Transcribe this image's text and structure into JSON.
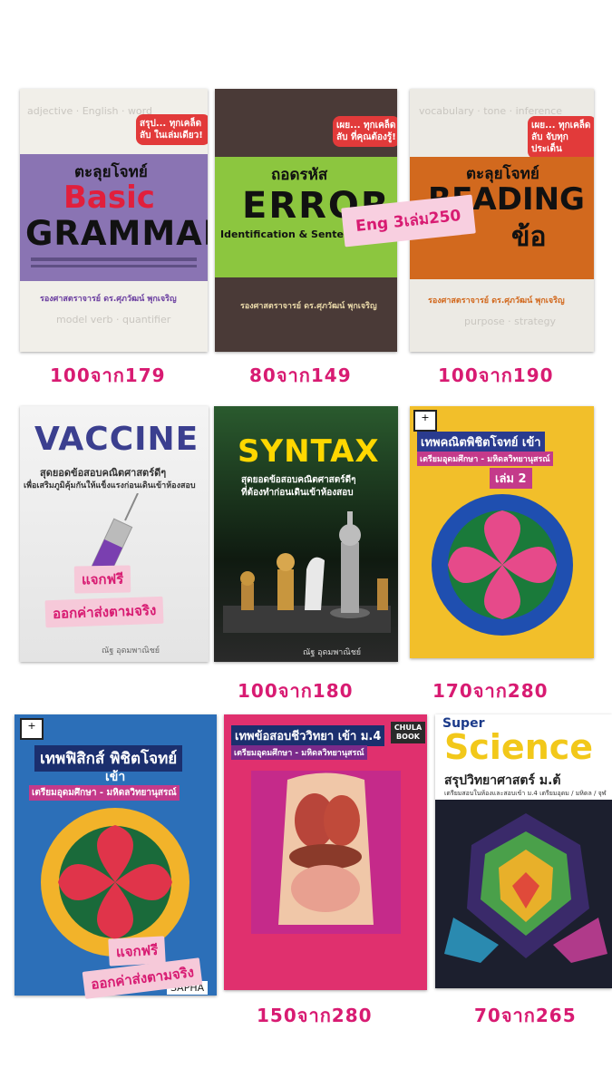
{
  "books": {
    "b1": {
      "badge": "สรุป... ทุกเคล็ดลับ ในเล่มเดียว!",
      "series": "ตะลุยโจทย์",
      "title_1": "Basic",
      "title_2": "GRAMMAR",
      "author": "รองศาสตราจารย์ ดร.ศุภวัฒน์ พุกเจริญ",
      "price": "100จาก179"
    },
    "b2": {
      "badge": "เผย... ทุกเคล็ดลับ ที่คุณต้องรู้!",
      "series": "ถอดรหัส",
      "title": "ERROR",
      "subtitle": "Identification & Sentence Comp",
      "author": "รองศาสตราจารย์ ดร.ศุภวัฒน์ พุกเจริญ",
      "price": "80จาก149"
    },
    "b3": {
      "badge": "เผย... ทุกเคล็ดลับ จับทุกประเด็น",
      "series": "ตะลุยโจทย์",
      "title": "READING",
      "title_2": "ข้อ",
      "author": "รองศาสตราจารย์ ดร.ศุภวัฒน์ พุกเจริญ",
      "price": "100จาก190"
    },
    "b4": {
      "title": "VACCINE",
      "subtitle_1": "สุดยอดข้อสอบคณิตศาสตร์ดีๆ",
      "subtitle_2": "เพื่อเสริมภูมิคุ้มกันให้แข็งแรงก่อนเดินเข้าห้องสอบ",
      "author": "ณัฐ อุดมพาณิชย์"
    },
    "b5": {
      "title": "SYNTAX",
      "subtitle_1": "สุดยอดข้อสอบคณิตศาสตร์ดีๆ",
      "subtitle_2": "ที่ต้องทำก่อนเดินเข้าห้องสอบ",
      "author": "ณัฐ อุดมพาณิชย์",
      "price": "100จาก180"
    },
    "b6": {
      "title_1": "เทพคณิตพิชิตโจทย์ เข้า",
      "title_2": "เตรียมอุดมศึกษา - มหิดลวิทยานุสรณ์",
      "volume": "เล่ม 2",
      "price": "170จาก280"
    },
    "b7": {
      "title_1": "เทพฟิสิกส์ พิชิตโจทย์",
      "title_2": "เข้า",
      "title_3": "เตรียมอุดมศึกษา - มหิดลวิทยานุสรณ์",
      "publisher": "SAPHA"
    },
    "b8": {
      "title_1": "เทพข้อสอบชีววิทยา เข้า ม.4",
      "title_2": "เตรียมอุดมศึกษา - มหิดลวิทยานุสรณ์",
      "publisher": "CHULA BOOK",
      "price": "150จาก280"
    },
    "b9": {
      "title_1": "Super",
      "title_2": "Science",
      "subtitle": "สรุปวิทยาศาสตร์ ม.ต้",
      "tagline": "เตรียมสอบในห้องและสอบเข้า ม.4 เตรียมอุดม / มหิดล / จุฬ",
      "price": "70จาก265"
    }
  },
  "stickers": {
    "bundle": "Eng 3เล่ม250",
    "free_1": "แจกฟรี",
    "shipping_1": "ออกค่าส่งตามจริง",
    "free_2": "แจกฟรี",
    "shipping_2": "ออกค่าส่งตามจริง"
  }
}
